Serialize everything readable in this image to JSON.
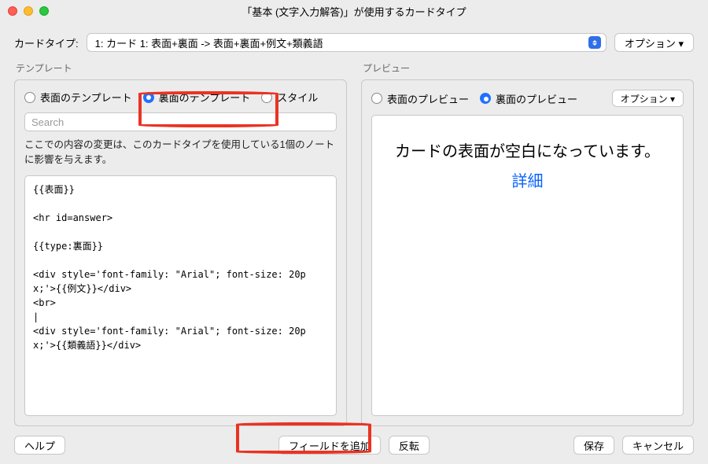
{
  "title": "「基本 (文字入力解答)」が使用するカードタイプ",
  "cardTypeLabel": "カードタイプ:",
  "cardTypeSelected": "1: カード 1: 表面+裏面 -> 表面+裏面+例文+類義語",
  "optionsBtn": "オプション ▾",
  "template": {
    "groupLabel": "テンプレート",
    "radioFront": "表面のテンプレート",
    "radioBack": "裏面のテンプレート",
    "radioStyle": "スタイル",
    "searchPlaceholder": "Search",
    "hint": "ここでの内容の変更は、このカードタイプを使用している1個のノートに影響を与えます。",
    "editorCode": "{{表面}}\n\n<hr id=answer>\n\n{{type:裏面}}\n\n<div style='font-family: \"Arial\"; font-size: 20px;'>{{例文}}</div>\n<br>\n|\n<div style='font-family: \"Arial\"; font-size: 20px;'>{{類義語}}</div>"
  },
  "preview": {
    "groupLabel": "プレビュー",
    "radioFront": "表面のプレビュー",
    "radioBack": "裏面のプレビュー",
    "optionsBtn": "オプション ▾",
    "message": "カードの表面が空白になっています。",
    "link": "詳細"
  },
  "footer": {
    "help": "ヘルプ",
    "addField": "フィールドを追加",
    "flip": "反転",
    "save": "保存",
    "cancel": "キャンセル"
  }
}
